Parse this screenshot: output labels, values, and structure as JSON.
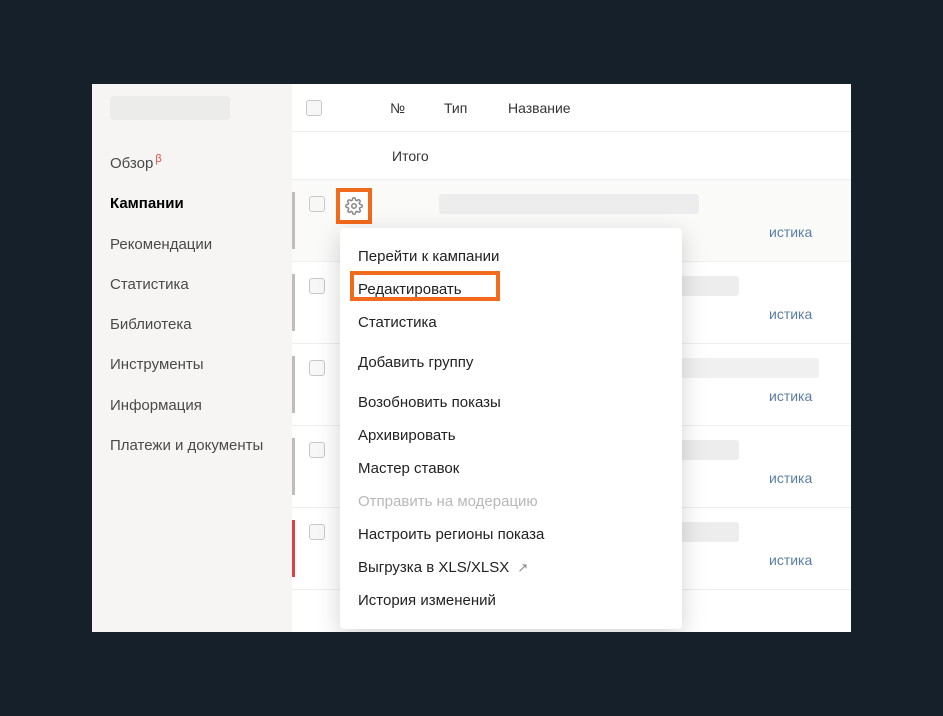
{
  "sidebar": {
    "items": [
      {
        "label": "Обзор",
        "beta": "β"
      },
      {
        "label": "Кампании",
        "active": true
      },
      {
        "label": "Рекомендации"
      },
      {
        "label": "Статистика"
      },
      {
        "label": "Библиотека"
      },
      {
        "label": "Инструменты"
      },
      {
        "label": "Информация"
      },
      {
        "label": "Платежи и документы"
      }
    ]
  },
  "table": {
    "headers": {
      "number": "№",
      "type": "Тип",
      "name": "Название"
    },
    "summary_label": "Итого",
    "stats_link_partial": "истика"
  },
  "dropdown": {
    "items": [
      {
        "label": "Перейти к кампании",
        "disabled": false
      },
      {
        "label": "Редактировать",
        "disabled": false,
        "highlighted": true
      },
      {
        "label": "Статистика",
        "disabled": false
      },
      {
        "label": "Добавить группу",
        "disabled": false
      },
      {
        "label": "Возобновить показы",
        "disabled": false
      },
      {
        "label": "Архивировать",
        "disabled": false
      },
      {
        "label": "Мастер ставок",
        "disabled": false
      },
      {
        "label": "Отправить на модерацию",
        "disabled": true
      },
      {
        "label": "Настроить регионы показа",
        "disabled": false
      },
      {
        "label": "Выгрузка в XLS/XLSX",
        "disabled": false,
        "external": true
      },
      {
        "label": "История изменений",
        "disabled": false
      }
    ]
  },
  "highlight_color": "#f26a1b"
}
